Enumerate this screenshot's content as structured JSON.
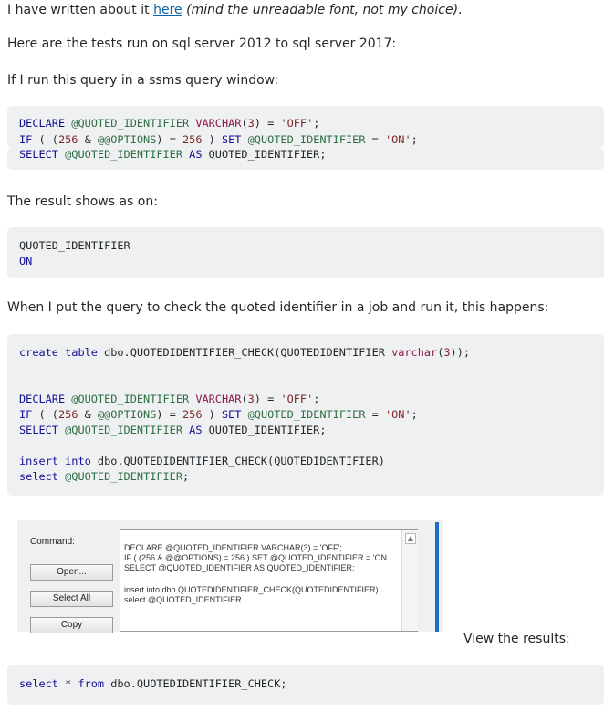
{
  "intro": {
    "before_link": "I have written about it ",
    "link": "here",
    "note": "(mind the unreadable font, not my choice)",
    "end": "."
  },
  "tests_text": "Here are the tests run on sql server 2012 to sql server 2017:",
  "run_text": "If I run this query in a ssms query window:",
  "result_text": "The result shows as on:",
  "job_text": "When I put the query to check the quoted identifier in a job and run it, this happens:",
  "view_results_text": "View the results:",
  "result_block": {
    "column": "QUOTED_IDENTIFIER",
    "value": "ON"
  },
  "job_step": {
    "command_label": "Command:",
    "buttons": [
      "Open...",
      "Select All",
      "Copy"
    ],
    "command_lines": [
      "DECLARE @QUOTED_IDENTIFIER VARCHAR(3) = 'OFF';",
      "IF ( (256 & @@OPTIONS) = 256 ) SET @QUOTED_IDENTIFIER = 'ON",
      "SELECT @QUOTED_IDENTIFIER AS QUOTED_IDENTIFIER;",
      "insert into dbo.QUOTEDIDENTIFIER_CHECK(QUOTEDIDENTIFIER)",
      "select @QUOTED_IDENTIFIER"
    ],
    "scroll_up_icon": "chevron-up-icon"
  },
  "colors": {
    "keyword": "#101094",
    "variable": "#2f6f44",
    "literal": "#7d2727",
    "link": "#0c65a5",
    "code_bg": "#eff0f1"
  }
}
